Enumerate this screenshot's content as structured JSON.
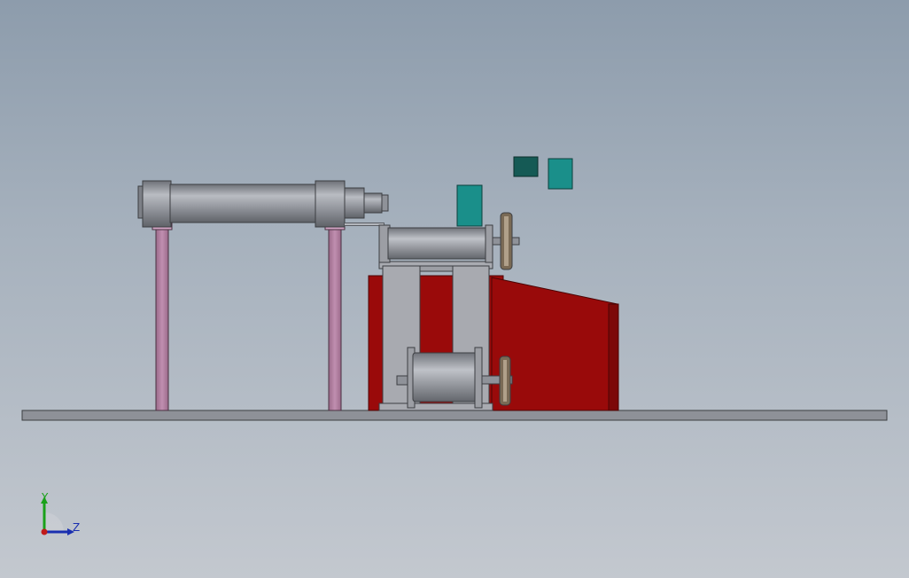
{
  "viewport": {
    "background_top": "#8d9cac",
    "background_bottom": "#c3c8cf"
  },
  "colors": {
    "base_plate": "#8e9198",
    "cylinder": "#8f9299",
    "leg": "#b27ea0",
    "leg_block": "#d2a4c4",
    "housing": "#9a0a0a",
    "frame": "#a9abb1",
    "teal_block": "#1a8f8a",
    "dark_teal_block": "#155a55"
  },
  "triad": {
    "y_label": "Y",
    "z_label": "Z",
    "y_axis_color": "#1aa11a",
    "z_axis_color": "#1a2fb0",
    "origin_color": "#c11a1a"
  }
}
